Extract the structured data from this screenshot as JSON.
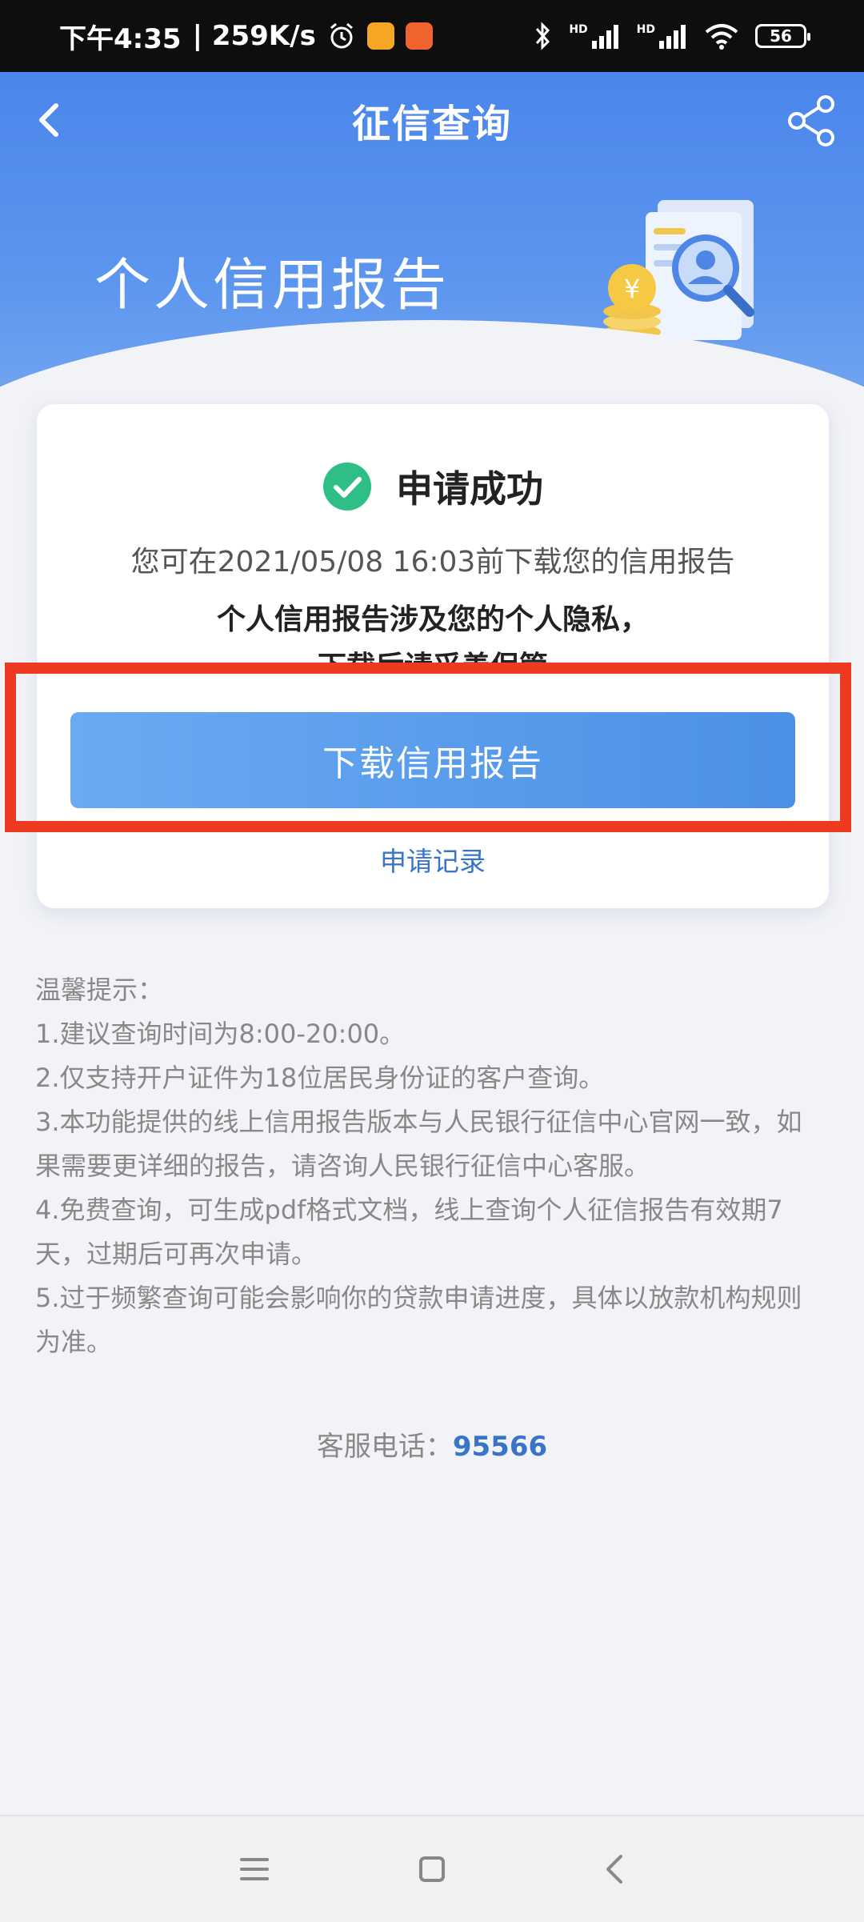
{
  "status_bar": {
    "time": "下午4:35",
    "speed": "| 259K/s",
    "battery": "56",
    "network_1": "HD",
    "network_2": "HD"
  },
  "nav": {
    "title": "征信查询"
  },
  "hero": {
    "title": "个人信用报告"
  },
  "card": {
    "success": "申请成功",
    "deadline": "您可在2021/05/08 16:03前下载您的信用报告",
    "privacy_line1": "个人信用报告涉及您的个人隐私，",
    "privacy_line2": "下载后请妥善保管",
    "download_button": "下载信用报告",
    "apply_record": "申请记录"
  },
  "tips": {
    "title": "温馨提示：",
    "items": [
      "1.建议查询时间为8:00-20:00。",
      "2.仅支持开户证件为18位居民身份证的客户查询。",
      "3.本功能提供的线上信用报告版本与人民银行征信中心官网一致，如",
      "果需要更详细的报告，请咨询人民银行征信中心客服。",
      "4.免费查询，可生成pdf格式文档，线上查询个人征信报告有效期7",
      "天，过期后可再次申请。",
      "5.过于频繁查询可能会影响你的贷款申请进度，具体以放款机构规则",
      "为准。"
    ]
  },
  "service": {
    "label": "客服电话：",
    "number": "95566"
  },
  "colors": {
    "primary": "#4a86eb",
    "button": "#5a9eee",
    "link": "#3a74c9",
    "success": "#2fbf86",
    "highlight": "#ef3a22"
  },
  "icons": {
    "back": "back-chevron-icon",
    "share": "share-icon",
    "success": "check-circle-icon",
    "menu": "menu-icon",
    "home": "home-square-icon",
    "nav_back": "back-triangle-icon"
  }
}
